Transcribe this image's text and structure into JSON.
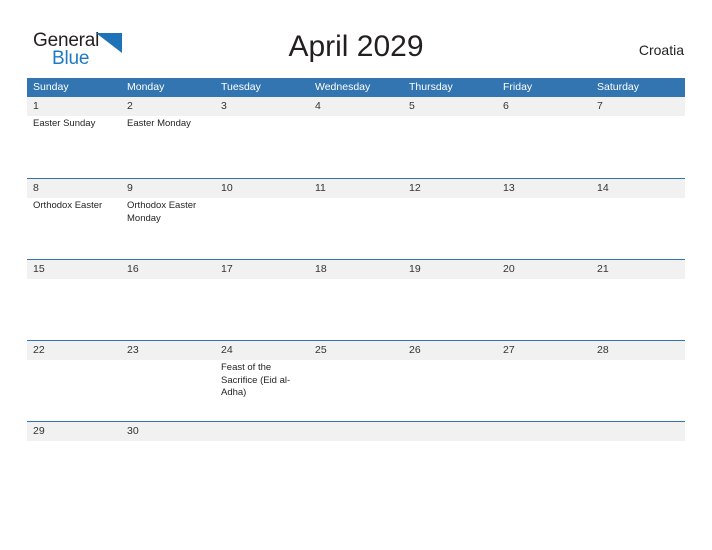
{
  "brand": {
    "name_part1": "General",
    "name_part2": "Blue",
    "flag_icon": "blue-triangle-flag-icon",
    "accent_color": "#1e72b8"
  },
  "header": {
    "title": "April 2029",
    "region": "Croatia"
  },
  "colors": {
    "header_blue": "#3275b1",
    "band_gray": "#f1f1f1",
    "text_dark": "#231f20",
    "logo_blue": "#1f7ac4"
  },
  "calendar": {
    "month": "April",
    "year": "2029",
    "weekdays": [
      "Sunday",
      "Monday",
      "Tuesday",
      "Wednesday",
      "Thursday",
      "Friday",
      "Saturday"
    ],
    "weeks": [
      [
        {
          "date": "1",
          "events": [
            "Easter Sunday"
          ]
        },
        {
          "date": "2",
          "events": [
            "Easter Monday"
          ]
        },
        {
          "date": "3",
          "events": []
        },
        {
          "date": "4",
          "events": []
        },
        {
          "date": "5",
          "events": []
        },
        {
          "date": "6",
          "events": []
        },
        {
          "date": "7",
          "events": []
        }
      ],
      [
        {
          "date": "8",
          "events": [
            "Orthodox Easter"
          ]
        },
        {
          "date": "9",
          "events": [
            "Orthodox Easter Monday"
          ]
        },
        {
          "date": "10",
          "events": []
        },
        {
          "date": "11",
          "events": []
        },
        {
          "date": "12",
          "events": []
        },
        {
          "date": "13",
          "events": []
        },
        {
          "date": "14",
          "events": []
        }
      ],
      [
        {
          "date": "15",
          "events": []
        },
        {
          "date": "16",
          "events": []
        },
        {
          "date": "17",
          "events": []
        },
        {
          "date": "18",
          "events": []
        },
        {
          "date": "19",
          "events": []
        },
        {
          "date": "20",
          "events": []
        },
        {
          "date": "21",
          "events": []
        }
      ],
      [
        {
          "date": "22",
          "events": []
        },
        {
          "date": "23",
          "events": []
        },
        {
          "date": "24",
          "events": [
            "Feast of the Sacrifice (Eid al-Adha)"
          ]
        },
        {
          "date": "25",
          "events": []
        },
        {
          "date": "26",
          "events": []
        },
        {
          "date": "27",
          "events": []
        },
        {
          "date": "28",
          "events": []
        }
      ],
      [
        {
          "date": "29",
          "events": []
        },
        {
          "date": "30",
          "events": []
        },
        {
          "date": "",
          "events": []
        },
        {
          "date": "",
          "events": []
        },
        {
          "date": "",
          "events": []
        },
        {
          "date": "",
          "events": []
        },
        {
          "date": "",
          "events": []
        }
      ]
    ]
  }
}
